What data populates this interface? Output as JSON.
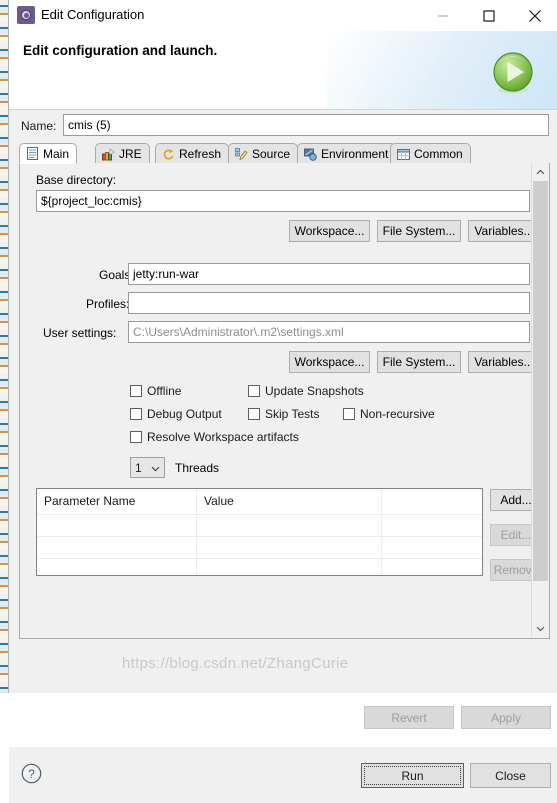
{
  "window": {
    "title": "Edit Configuration",
    "app_icon": "gear-icon",
    "minimize_label": "Minimize",
    "maximize_label": "Maximize",
    "close_label": "Close"
  },
  "header": {
    "title": "Edit configuration and launch.",
    "badge_icon": "run-play-icon"
  },
  "name_field": {
    "label": "Name:",
    "value": "cmis (5)"
  },
  "tabs": [
    {
      "label": "Main",
      "icon": "document-icon",
      "active": true
    },
    {
      "label": "JRE",
      "icon": "books-icon",
      "active": false
    },
    {
      "label": "Refresh",
      "icon": "refresh-icon",
      "active": false
    },
    {
      "label": "Source",
      "icon": "source-edit-icon",
      "active": false
    },
    {
      "label": "Environment",
      "icon": "environment-icon",
      "active": false
    },
    {
      "label": "Common",
      "icon": "common-table-icon",
      "active": false
    }
  ],
  "main_tab": {
    "base_directory": {
      "label": "Base directory:",
      "value": "${project_loc:cmis}"
    },
    "dir_buttons": [
      {
        "label": "Workspace...",
        "enabled": true
      },
      {
        "label": "File System...",
        "enabled": true
      },
      {
        "label": "Variables...",
        "enabled": true
      }
    ],
    "goals": {
      "label": "Goals:",
      "value": "jetty:run-war"
    },
    "profiles": {
      "label": "Profiles:",
      "value": ""
    },
    "user_settings": {
      "label": "User settings:",
      "value": "C:\\Users\\Administrator\\.m2\\settings.xml"
    },
    "settings_buttons": [
      {
        "label": "Workspace...",
        "enabled": true
      },
      {
        "label": "File System...",
        "enabled": true
      },
      {
        "label": "Variables...",
        "enabled": true
      }
    ],
    "checkboxes": [
      {
        "label": "Offline",
        "checked": false
      },
      {
        "label": "Update Snapshots",
        "checked": false
      },
      {
        "label": "Debug Output",
        "checked": false
      },
      {
        "label": "Skip Tests",
        "checked": false
      },
      {
        "label": "Non-recursive",
        "checked": false
      },
      {
        "label": "Resolve Workspace artifacts",
        "checked": false
      }
    ],
    "threads": {
      "value": "1",
      "label": "Threads"
    },
    "parameters_table": {
      "columns": [
        "Parameter Name",
        "Value",
        ""
      ],
      "rows": []
    },
    "table_buttons": [
      {
        "label": "Add...",
        "enabled": true
      },
      {
        "label": "Edit...",
        "enabled": false
      },
      {
        "label": "Remove",
        "enabled": false
      }
    ]
  },
  "panel_actions": [
    {
      "label": "Revert",
      "enabled": false
    },
    {
      "label": "Apply",
      "enabled": false
    }
  ],
  "footer": {
    "help_icon": "help-question-icon",
    "run_label": "Run",
    "close_label": "Close"
  },
  "watermark": "https://blog.csdn.net/ZhangCurie",
  "colors": {
    "dialog_bg": "#f0f0f0",
    "header_accent": "#cde6f6",
    "focus_blue": "#0078d7",
    "run_green": "#6cb33f",
    "disabled_text": "#9d9d9d"
  }
}
